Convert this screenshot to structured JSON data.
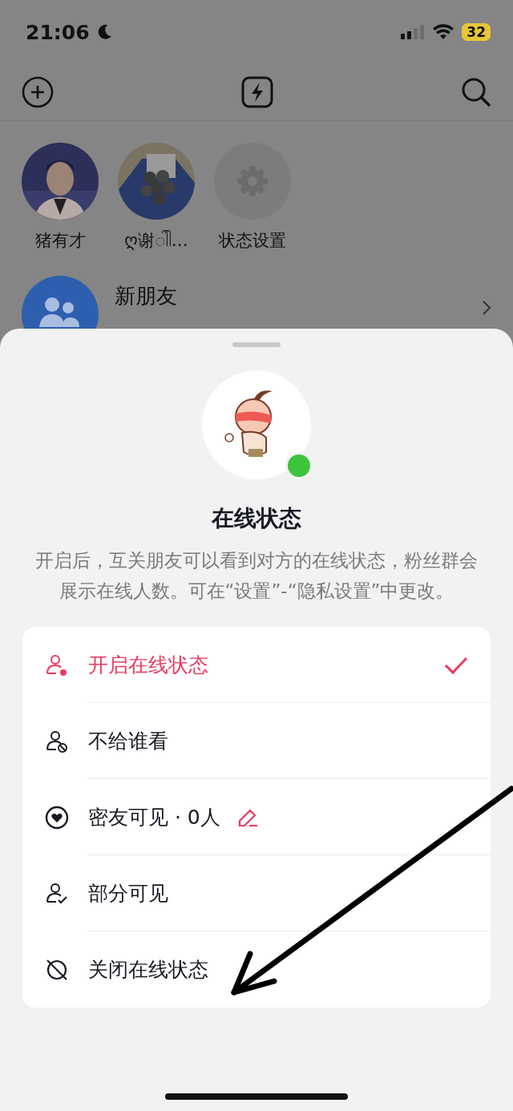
{
  "status_bar": {
    "time": "21:06",
    "battery": "32"
  },
  "stories": [
    {
      "name": "猪有才",
      "kind": "picture"
    },
    {
      "name": "ღ谢ါါ…",
      "kind": "picture"
    },
    {
      "name": "状态设置",
      "kind": "settings"
    }
  ],
  "new_friends": {
    "title": "新朋友"
  },
  "sheet": {
    "title": "在线状态",
    "online": true,
    "description": "开启后，互关朋友可以看到对方的在线状态，粉丝群会展示在线人数。可在“设置”-“隐私设置”中更改。",
    "options": [
      {
        "label": "开启在线状态",
        "kind": "on",
        "selected": true
      },
      {
        "label": "不给谁看",
        "kind": "block",
        "selected": false
      },
      {
        "label": "密友可见 · 0人",
        "kind": "friends",
        "selected": false,
        "editable": true
      },
      {
        "label": "部分可见",
        "kind": "partial",
        "selected": false
      },
      {
        "label": "关闭在线状态",
        "kind": "off",
        "selected": false
      }
    ]
  }
}
